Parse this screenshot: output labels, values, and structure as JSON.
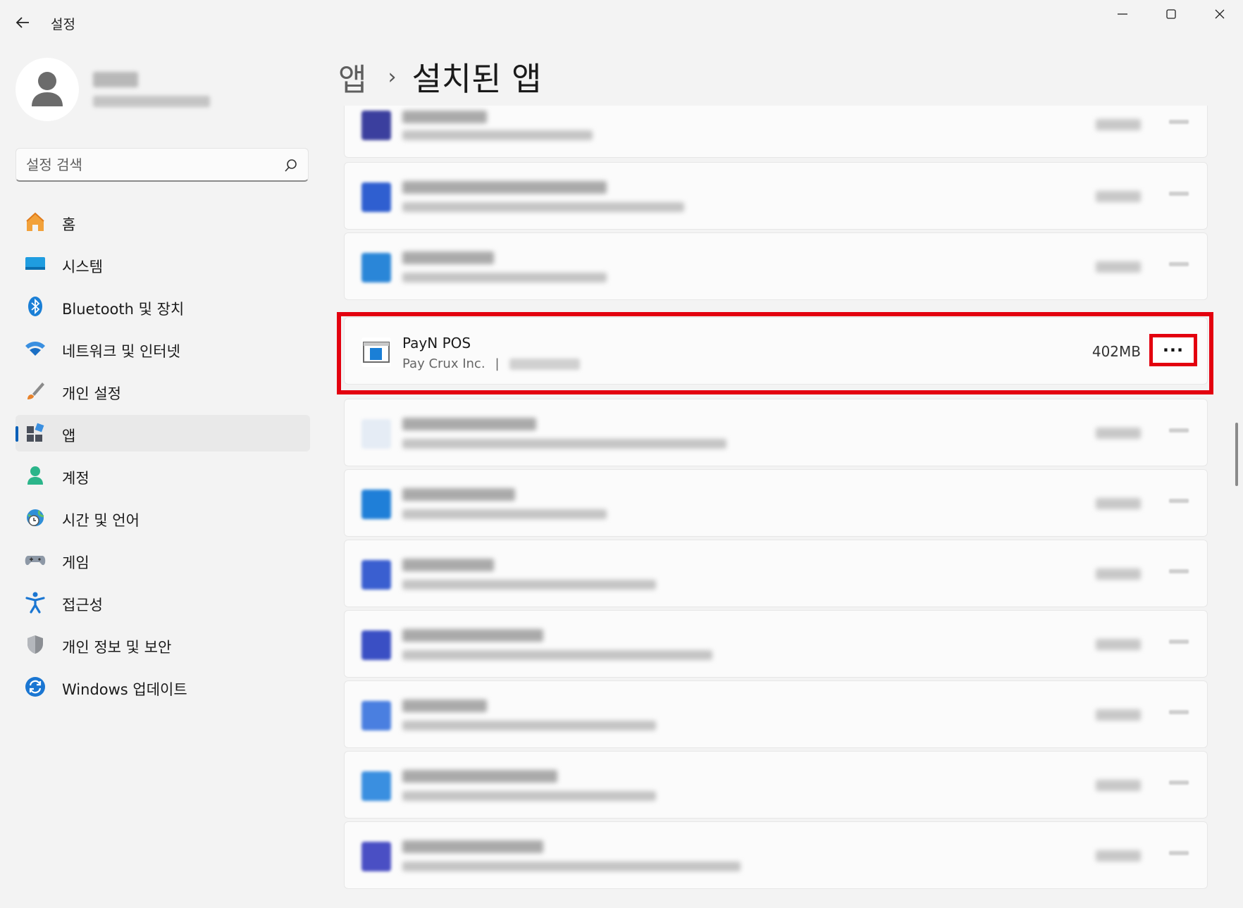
{
  "window": {
    "title": "설정"
  },
  "search": {
    "placeholder": "설정 검색"
  },
  "nav": {
    "items": [
      {
        "label": "홈"
      },
      {
        "label": "시스템"
      },
      {
        "label": "Bluetooth 및 장치"
      },
      {
        "label": "네트워크 및 인터넷"
      },
      {
        "label": "개인 설정"
      },
      {
        "label": "앱",
        "active": true
      },
      {
        "label": "계정"
      },
      {
        "label": "시간 및 언어"
      },
      {
        "label": "게임"
      },
      {
        "label": "접근성"
      },
      {
        "label": "개인 정보 및 보안"
      },
      {
        "label": "Windows 업데이트"
      }
    ]
  },
  "breadcrumb": {
    "parent": "앱",
    "separator": "›",
    "current": "설치된 앱"
  },
  "focused_app": {
    "name": "PayN POS",
    "publisher": "Pay Crux Inc.",
    "meta_separator": "|",
    "size": "402MB",
    "more_label": "···"
  },
  "colors": {
    "highlight": "#e3000f",
    "accent": "#005fb8"
  }
}
